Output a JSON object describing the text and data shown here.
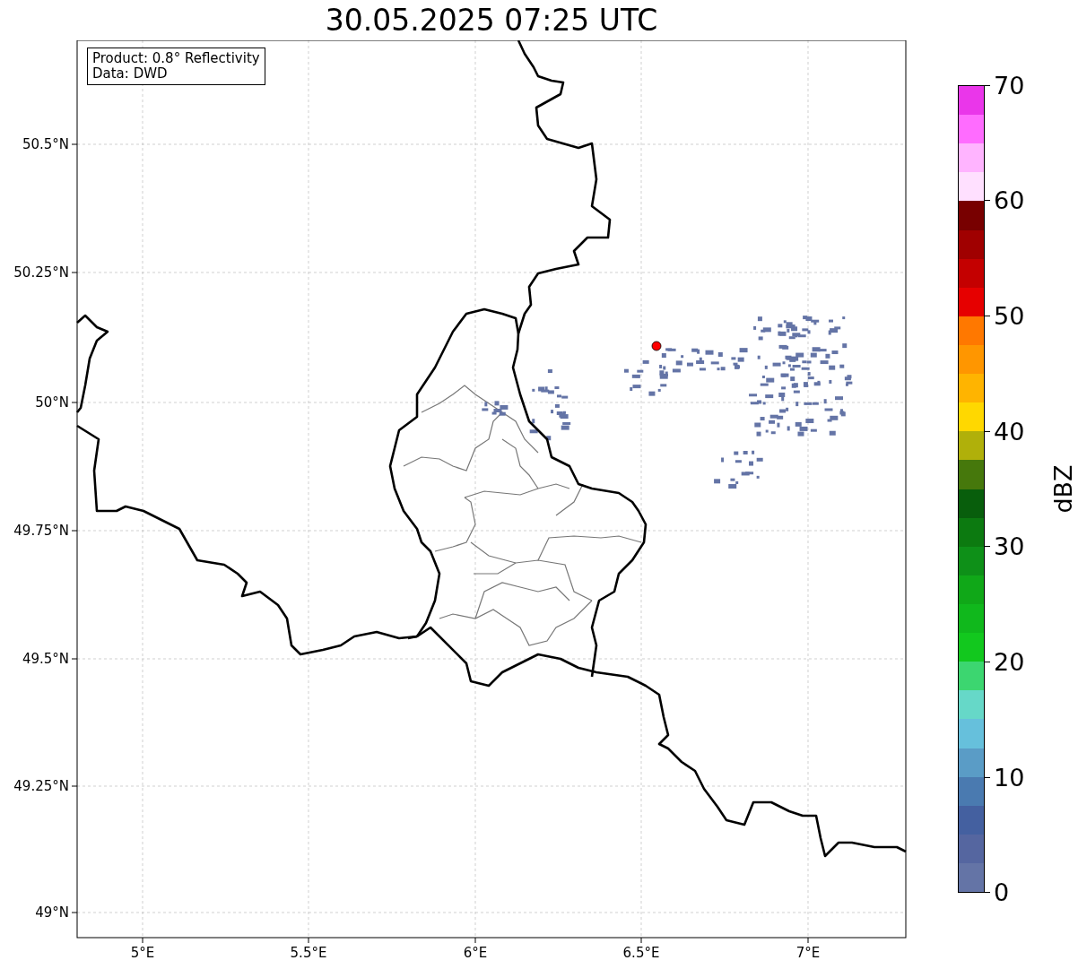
{
  "title": "30.05.2025 07:25 UTC",
  "info_box": [
    "Product: 0.8° Reflectivity",
    "Data: DWD"
  ],
  "map": {
    "lat_ticks": [
      "50.5°N",
      "50.25°N",
      "50°N",
      "49.75°N",
      "49.5°N",
      "49.25°N",
      "49°N"
    ],
    "lon_ticks": [
      "5°E",
      "5.5°E",
      "6°E",
      "6.5°E",
      "7°E"
    ]
  },
  "colorbar": {
    "label": "dBZ",
    "ticks": [
      "70",
      "60",
      "50",
      "40",
      "30",
      "20",
      "10",
      "0"
    ],
    "bins": [
      {
        "color": "#ea36ea"
      },
      {
        "color": "#ff6cff"
      },
      {
        "color": "#ffb4ff"
      },
      {
        "color": "#ffe0ff"
      },
      {
        "color": "#780000"
      },
      {
        "color": "#a00000"
      },
      {
        "color": "#c40000"
      },
      {
        "color": "#e60000"
      },
      {
        "color": "#ff7800"
      },
      {
        "color": "#ff9600"
      },
      {
        "color": "#ffb400"
      },
      {
        "color": "#ffd800"
      },
      {
        "color": "#b0b00a"
      },
      {
        "color": "#46780c"
      },
      {
        "color": "#085e0c"
      },
      {
        "color": "#0c7a10"
      },
      {
        "color": "#0e9018"
      },
      {
        "color": "#10a818"
      },
      {
        "color": "#10b81c"
      },
      {
        "color": "#12c81e"
      },
      {
        "color": "#3cd670"
      },
      {
        "color": "#66d8c8"
      },
      {
        "color": "#66c0dc"
      },
      {
        "color": "#5a9cc6"
      },
      {
        "color": "#4a7ab0"
      },
      {
        "color": "#4460a0"
      },
      {
        "color": "#5566a0"
      },
      {
        "color": "#6474a6"
      }
    ]
  }
}
